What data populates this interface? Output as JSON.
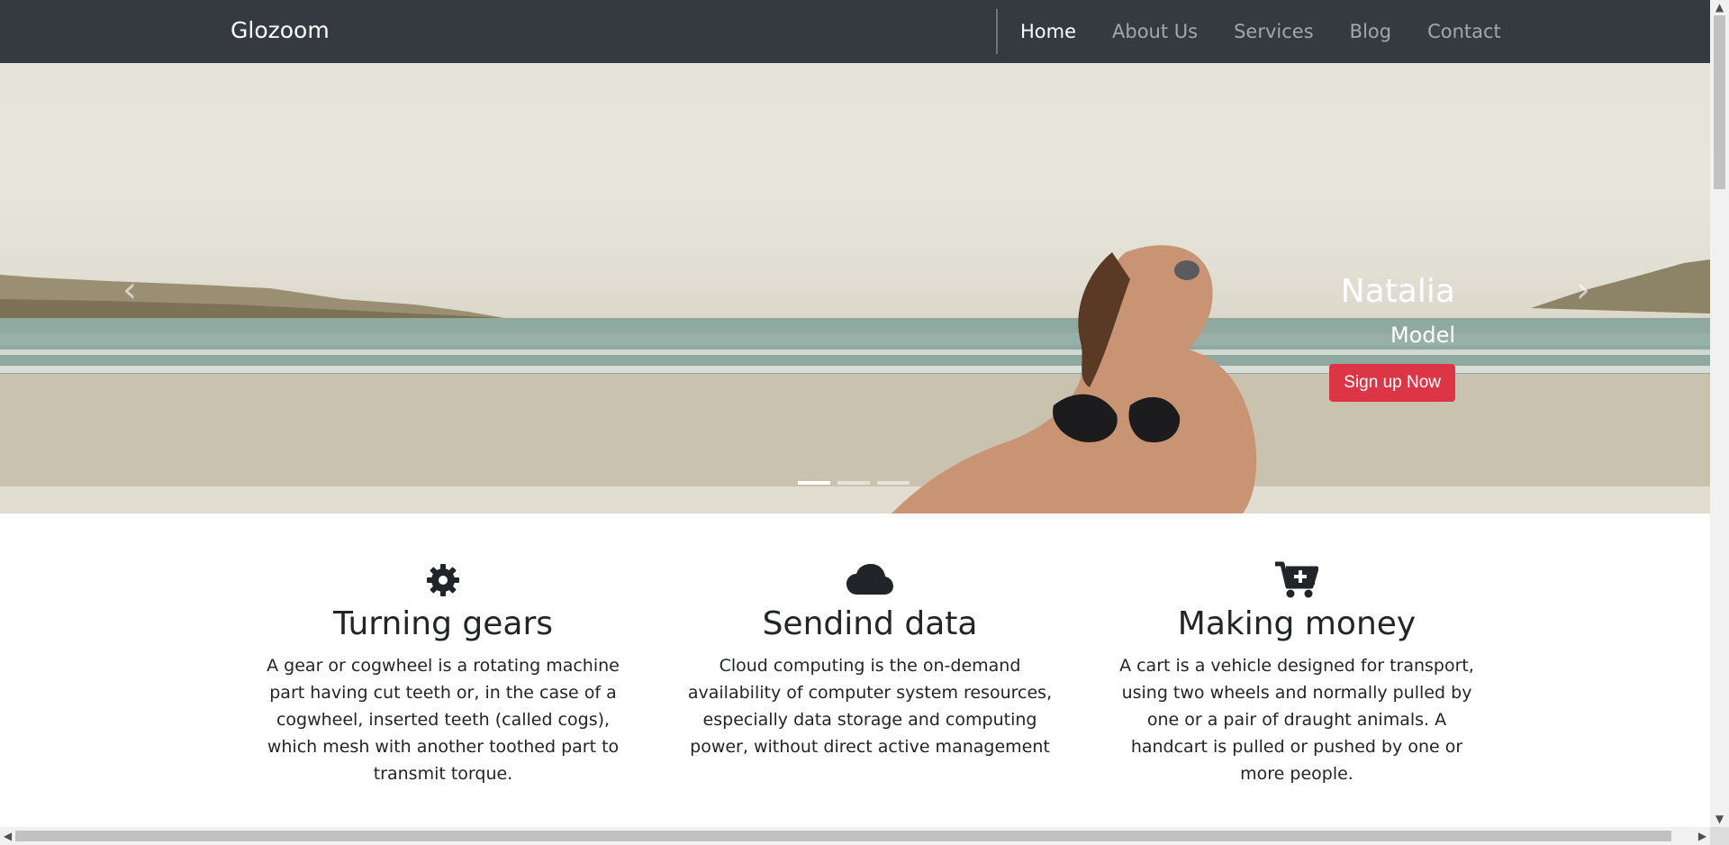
{
  "navbar": {
    "brand": "Glozoom",
    "links": [
      {
        "label": "Home",
        "active": true
      },
      {
        "label": "About Us",
        "active": false
      },
      {
        "label": "Services",
        "active": false
      },
      {
        "label": "Blog",
        "active": false
      },
      {
        "label": "Contact",
        "active": false
      }
    ]
  },
  "hero": {
    "name": "Natalia",
    "role": "Model",
    "cta_label": "Sign up Now",
    "cta_color": "#dc3545",
    "prev_icon": "chevron-left-icon",
    "next_icon": "chevron-right-icon",
    "slides_total": 3,
    "active_slide": 1
  },
  "features": [
    {
      "icon": "gear-icon",
      "title": "Turning gears",
      "text": "A gear or cogwheel is a rotating machine part having cut teeth or, in the case of a cogwheel, inserted teeth (called cogs), which mesh with another toothed part to transmit torque."
    },
    {
      "icon": "cloud-icon",
      "title": "Sendind data",
      "text": "Cloud computing is the on-demand availability of computer system resources, especially data storage and computing power, without direct active management"
    },
    {
      "icon": "cart-plus-icon",
      "title": "Making money",
      "text": "A cart is a vehicle designed for transport, using two wheels and normally pulled by one or a pair of draught animals. A handcart is pulled or pushed by one or more people."
    }
  ],
  "colors": {
    "navbar_bg": "#343a40",
    "text": "#212529"
  }
}
